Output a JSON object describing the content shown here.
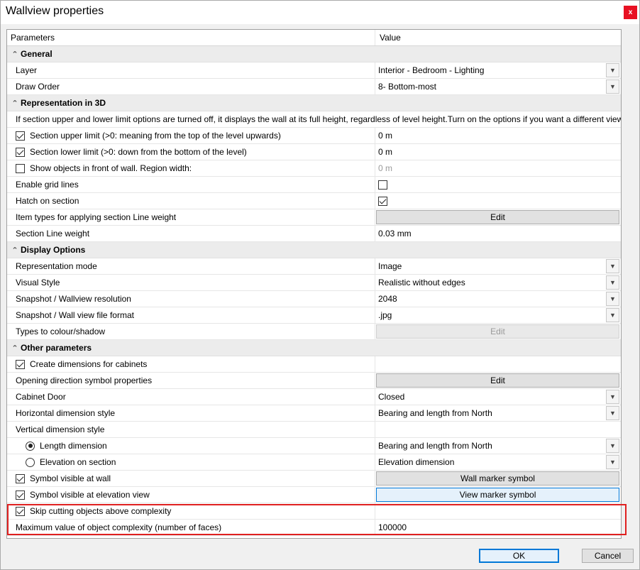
{
  "window": {
    "title": "Wallview properties",
    "close_label": "x"
  },
  "grid": {
    "col_parameters": "Parameters",
    "col_value": "Value"
  },
  "general": {
    "title": "General",
    "layer_label": "Layer",
    "layer_value": "Interior - Bedroom - Lighting",
    "draw_order_label": "Draw Order",
    "draw_order_value": "8- Bottom-most"
  },
  "rep3d": {
    "title": "Representation in 3D",
    "info": "If section upper and lower limit options are turned off, it displays the wall at its full height, regardless of level height.Turn on the options if you want a different view.",
    "upper_label": "Section upper limit (>0: meaning from the top of the level upwards)",
    "upper_value": "0 m",
    "lower_label": "Section lower limit (>0: down from the bottom of the level)",
    "lower_value": "0 m",
    "front_label": "Show objects in front of wall. Region width:",
    "front_value": "0 m",
    "grid_lines_label": "Enable grid lines",
    "hatch_label": "Hatch on section",
    "item_types_label": "Item types for applying section Line weight",
    "item_types_button": "Edit",
    "line_weight_label": "Section Line weight",
    "line_weight_value": "0.03 mm"
  },
  "display": {
    "title": "Display Options",
    "rep_mode_label": "Representation mode",
    "rep_mode_value": "Image",
    "visual_style_label": "Visual Style",
    "visual_style_value": "Realistic without edges",
    "resolution_label": "Snapshot / Wallview resolution",
    "resolution_value": "2048",
    "format_label": "Snapshot / Wall view file format",
    "format_value": ".jpg",
    "types_label": "Types to colour/shadow",
    "types_button": "Edit"
  },
  "other": {
    "title": "Other parameters",
    "create_dims_label": "Create dimensions for cabinets",
    "opening_label": "Opening direction symbol properties",
    "opening_button": "Edit",
    "cabinet_door_label": "Cabinet Door",
    "cabinet_door_value": "Closed",
    "hdim_label": "Horizontal dimension style",
    "hdim_value": "Bearing and length from North",
    "vdim_label": "Vertical dimension style",
    "length_dim_label": "Length dimension",
    "length_dim_value": "Bearing and length from North",
    "elev_label": "Elevation on section",
    "elev_value": "Elevation dimension",
    "sym_wall_label": "Symbol visible at wall",
    "sym_wall_button": "Wall marker symbol",
    "sym_elev_label": "Symbol visible at elevation view",
    "sym_elev_button": "View marker symbol",
    "skip_label": "Skip cutting objects above complexity",
    "max_label": "Maximum value of object complexity (number of faces)",
    "max_value": "100000"
  },
  "footer": {
    "ok": "OK",
    "cancel": "Cancel"
  },
  "colors": {
    "highlight": "#e02020",
    "focus": "#0078d7",
    "close": "#e81123"
  }
}
